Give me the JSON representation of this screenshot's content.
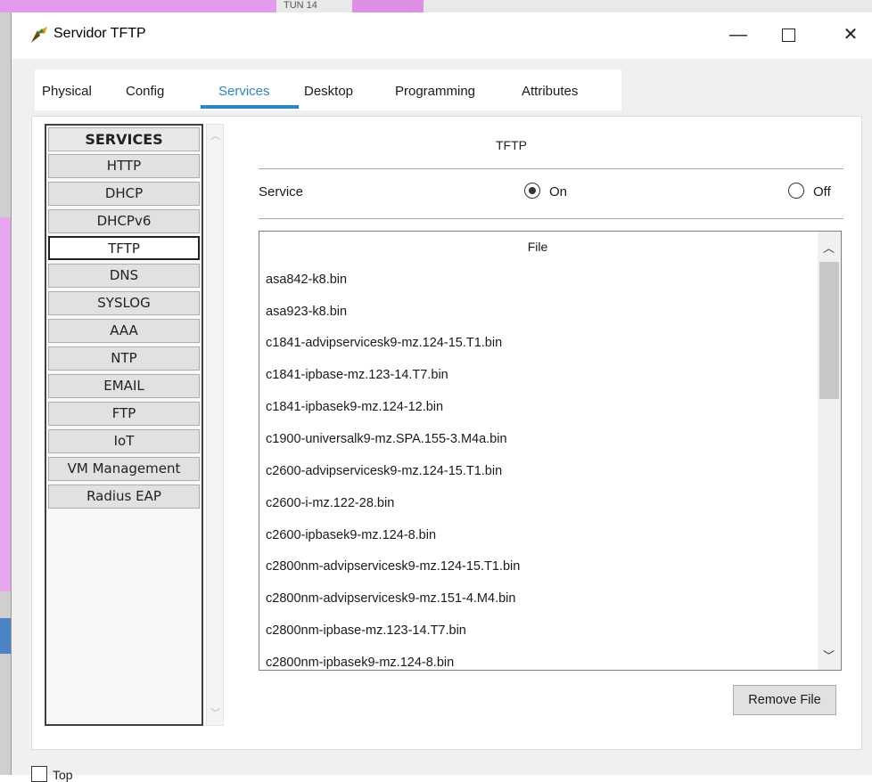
{
  "background": {
    "text": "TUN 14"
  },
  "window": {
    "title": "Servidor TFTP",
    "icon": "router-icon",
    "controls": {
      "minimize": "—",
      "close": "✕"
    }
  },
  "tabs": [
    {
      "label": "Physical",
      "active": false
    },
    {
      "label": "Config",
      "active": false
    },
    {
      "label": "Services",
      "active": true
    },
    {
      "label": "Desktop",
      "active": false
    },
    {
      "label": "Programming",
      "active": false
    },
    {
      "label": "Attributes",
      "active": false
    }
  ],
  "services": {
    "header": "SERVICES",
    "items": [
      "HTTP",
      "DHCP",
      "DHCPv6",
      "TFTP",
      "DNS",
      "SYSLOG",
      "AAA",
      "NTP",
      "EMAIL",
      "FTP",
      "IoT",
      "VM Management",
      "Radius EAP"
    ],
    "selected": "TFTP"
  },
  "tftp": {
    "title": "TFTP",
    "service_label": "Service",
    "on_label": "On",
    "off_label": "Off",
    "selected": "On",
    "file_header": "File",
    "files": [
      "asa842-k8.bin",
      "asa923-k8.bin",
      "c1841-advipservicesk9-mz.124-15.T1.bin",
      "c1841-ipbase-mz.123-14.T7.bin",
      "c1841-ipbasek9-mz.124-12.bin",
      "c1900-universalk9-mz.SPA.155-3.M4a.bin",
      "c2600-advipservicesk9-mz.124-15.T1.bin",
      "c2600-i-mz.122-28.bin",
      "c2600-ipbasek9-mz.124-8.bin",
      "c2800nm-advipservicesk9-mz.124-15.T1.bin",
      "c2800nm-advipservicesk9-mz.151-4.M4.bin",
      "c2800nm-ipbase-mz.123-14.T7.bin",
      "c2800nm-ipbasek9-mz.124-8.bin"
    ],
    "remove_button": "Remove File"
  },
  "footer": {
    "top_label": "Top"
  },
  "colors": {
    "accent": "#2a86c9",
    "panel_bg": "#f0f0f0"
  }
}
